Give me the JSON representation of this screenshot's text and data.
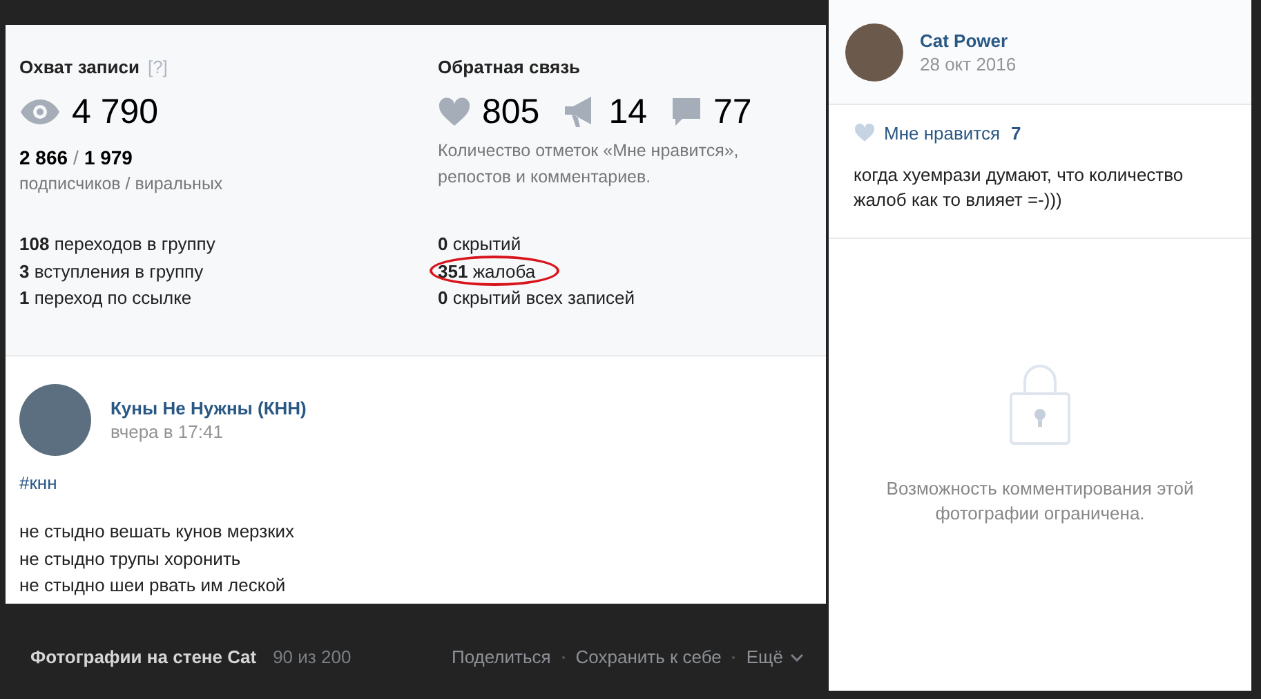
{
  "photo": {
    "reach": {
      "title": "Охват записи",
      "help": "[?]",
      "views": "4 790",
      "subscribers": "2 866",
      "separator": "/",
      "viral": "1 979",
      "caption": "подписчиков / виральных"
    },
    "feedback": {
      "title": "Обратная связь",
      "likes": "805",
      "reposts": "14",
      "comments": "77",
      "caption": "Количество отметок «Мне нравится», репостов и комментариев."
    },
    "group_stats": [
      {
        "text": "**108** переходов в группу",
        "circled": false
      },
      {
        "text": "**3** вступления в группу",
        "circled": false
      },
      {
        "text": "**1** переход по ссылке",
        "circled": false
      }
    ],
    "feedback_stats": [
      {
        "text": "**0** скрытий",
        "circled": false
      },
      {
        "text": "**351** жалоба",
        "circled": true
      },
      {
        "text": "**0** скрытий всех записей",
        "circled": false
      }
    ],
    "post": {
      "author": "Куны Не Нужны (КНН)",
      "time": "вчера в 17:41",
      "hashtag": "#кнн",
      "lines": [
        "не стыдно вешать кунов мерзких",
        "не стыдно трупы хоронить",
        "не стыдно шеи рвать им леской"
      ]
    }
  },
  "footer": {
    "album": "Фотографии на стене Cat",
    "counter": "90 из 200",
    "actions": [
      {
        "label": "Поделиться",
        "kind": "link"
      },
      {
        "label": "Сохранить к себе",
        "kind": "link"
      },
      {
        "label": "Ещё",
        "kind": "menu"
      }
    ]
  },
  "sidebar": {
    "owner": {
      "name": "Cat Power",
      "date": "28 окт 2016"
    },
    "likes": {
      "label": "Мне нравится",
      "count": "7",
      "liked": false
    },
    "description": "когда хуемрази думают, что количество жалоб как то влияет =-)))",
    "notice": "Возможность комментирования этой фотографии ограничена."
  }
}
